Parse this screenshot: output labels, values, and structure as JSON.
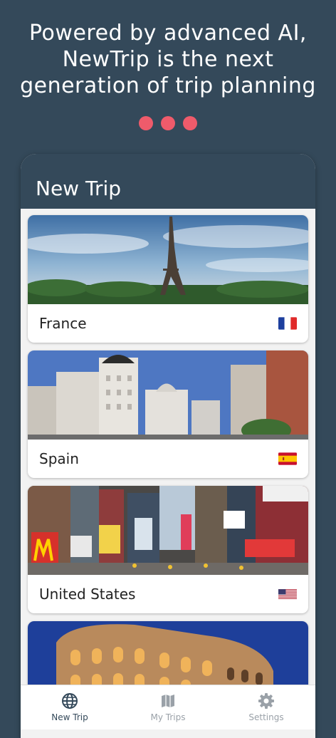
{
  "headline": {
    "line1": "Powered by advanced AI,",
    "line2": "NewTrip is the next",
    "line3": "generation of trip planning"
  },
  "pager": {
    "count": 3,
    "color": "#ef5b6b"
  },
  "appbar": {
    "title": "New Trip"
  },
  "destinations": [
    {
      "name": "France",
      "flag": "france-flag-icon"
    },
    {
      "name": "Spain",
      "flag": "spain-flag-icon"
    },
    {
      "name": "United States",
      "flag": "us-flag-icon"
    },
    {
      "name": "",
      "flag": ""
    }
  ],
  "navbar": {
    "items": [
      {
        "label": "New Trip",
        "icon": "globe-icon",
        "active": true
      },
      {
        "label": "My Trips",
        "icon": "map-icon",
        "active": false
      },
      {
        "label": "Settings",
        "icon": "gear-icon",
        "active": false
      }
    ]
  },
  "colors": {
    "primary": "#34495a",
    "accent": "#ef5b6b"
  }
}
